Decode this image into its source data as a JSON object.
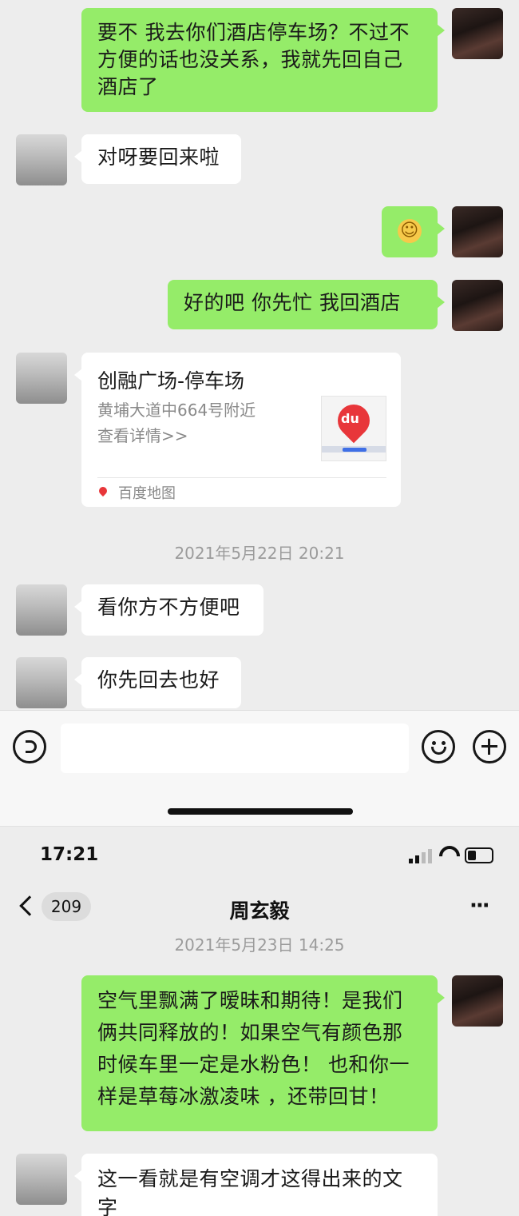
{
  "messages_top": {
    "m1": "要不 我去你们酒店停车场？不过不方便的话也没关系，我就先回自己酒店了",
    "m2": "对呀要回来啦",
    "m3_emoji": "☺",
    "m4": "好的吧  你先忙  我回酒店",
    "location": {
      "title": "创融广场-停车场",
      "address": "黄埔大道中664号附近",
      "details": "查看详情>>",
      "source": "百度地图",
      "logo_text": "du"
    },
    "timestamp1": "2021年5月22日 20:21",
    "m5": "看你方不方便吧",
    "m6": "你先回去也好"
  },
  "input_bar": {
    "voice_icon": "voice-icon",
    "emoji_icon": "emoji-icon",
    "add_icon": "plus-circle-icon"
  },
  "status_bar": {
    "time": "17:21"
  },
  "nav": {
    "back_count": "209",
    "title": "周玄毅",
    "more": "···"
  },
  "messages_bottom": {
    "timestamp2": "2021年5月23日 14:25",
    "m7": "空气里飘满了暧昧和期待！是我们俩共同释放的！如果空气有颜色那时候车里一定是水粉色！ 也和你一样是草莓冰激凌味 ，还带回甘！",
    "m8": "这一看就是有空调才这得出来的文字"
  },
  "colors": {
    "outgoing_bubble": "#95ec69",
    "incoming_bubble": "#ffffff",
    "background": "#ededed"
  }
}
